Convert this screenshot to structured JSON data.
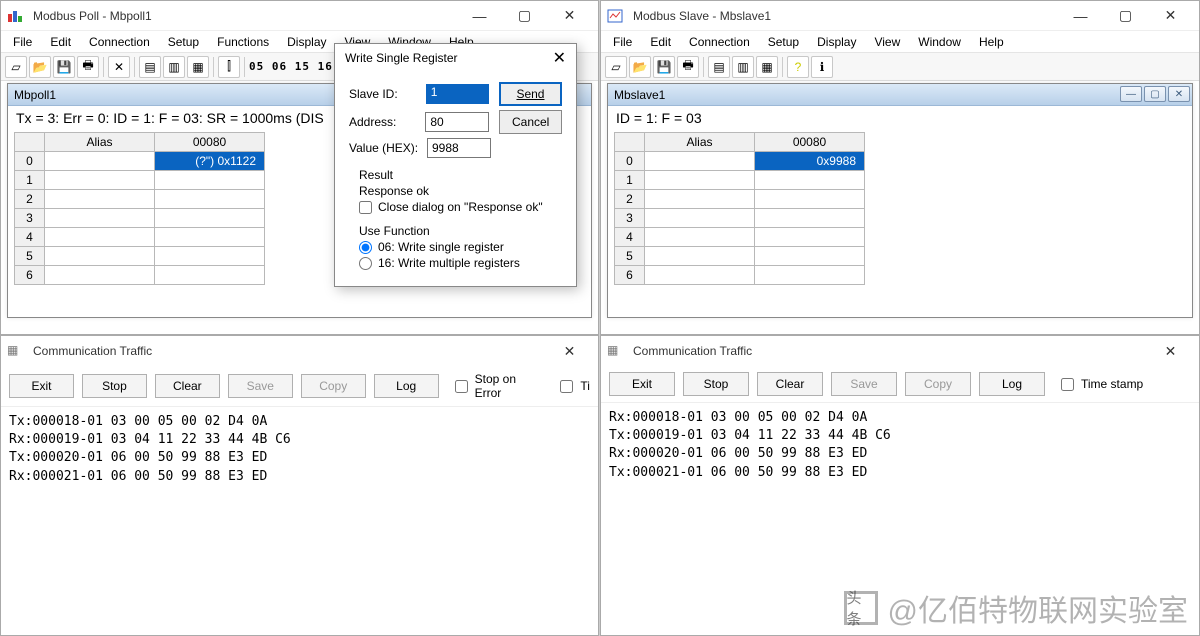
{
  "poll": {
    "title": "Modbus Poll - Mbpoll1",
    "menu": [
      "File",
      "Edit",
      "Connection",
      "Setup",
      "Functions",
      "Display",
      "View",
      "Window",
      "Help"
    ],
    "fcodes": "05 06 15 16",
    "doc_title": "Mbpoll1",
    "status": "Tx = 3: Err = 0: ID = 1: F = 03: SR = 1000ms  (DIS",
    "col_alias": "Alias",
    "col_val": "00080",
    "rows": [
      "0",
      "1",
      "2",
      "3",
      "4",
      "5",
      "6"
    ],
    "cell0": "(?\") 0x1122",
    "traffic_title": "Communication Traffic",
    "btns": {
      "exit": "Exit",
      "stop": "Stop",
      "clear": "Clear",
      "save": "Save",
      "copy": "Copy",
      "log": "Log"
    },
    "chk_soe": "Stop on Error",
    "chk_ts_short": "Ti",
    "log": "Tx:000018-01 03 00 05 00 02 D4 0A\nRx:000019-01 03 04 11 22 33 44 4B C6\nTx:000020-01 06 00 50 99 88 E3 ED\nRx:000021-01 06 00 50 99 88 E3 ED"
  },
  "slave": {
    "title": "Modbus Slave - Mbslave1",
    "menu": [
      "File",
      "Edit",
      "Connection",
      "Setup",
      "Display",
      "View",
      "Window",
      "Help"
    ],
    "doc_title": "Mbslave1",
    "status": "ID = 1: F = 03",
    "col_alias": "Alias",
    "col_val": "00080",
    "rows": [
      "0",
      "1",
      "2",
      "3",
      "4",
      "5",
      "6"
    ],
    "cell0": "0x9988",
    "traffic_title": "Communication Traffic",
    "btns": {
      "exit": "Exit",
      "stop": "Stop",
      "clear": "Clear",
      "save": "Save",
      "copy": "Copy",
      "log": "Log"
    },
    "chk_ts": "Time stamp",
    "log": "Rx:000018-01 03 00 05 00 02 D4 0A\nTx:000019-01 03 04 11 22 33 44 4B C6\nRx:000020-01 06 00 50 99 88 E3 ED\nTx:000021-01 06 00 50 99 88 E3 ED"
  },
  "dialog": {
    "title": "Write Single Register",
    "lbl_slave": "Slave ID:",
    "lbl_addr": "Address:",
    "lbl_val": "Value (HEX):",
    "val_slave": "1",
    "val_addr": "80",
    "val_val": "9988",
    "btn_send": "Send",
    "btn_cancel": "Cancel",
    "grp_result": "Result",
    "result_text": "Response ok",
    "chk_close": "Close dialog on \"Response ok\"",
    "grp_use": "Use Function",
    "opt_06": "06: Write single register",
    "opt_16": "16: Write multiple registers"
  },
  "watermark": {
    "logo": "头条",
    "text": "@亿佰特物联网实验室"
  }
}
